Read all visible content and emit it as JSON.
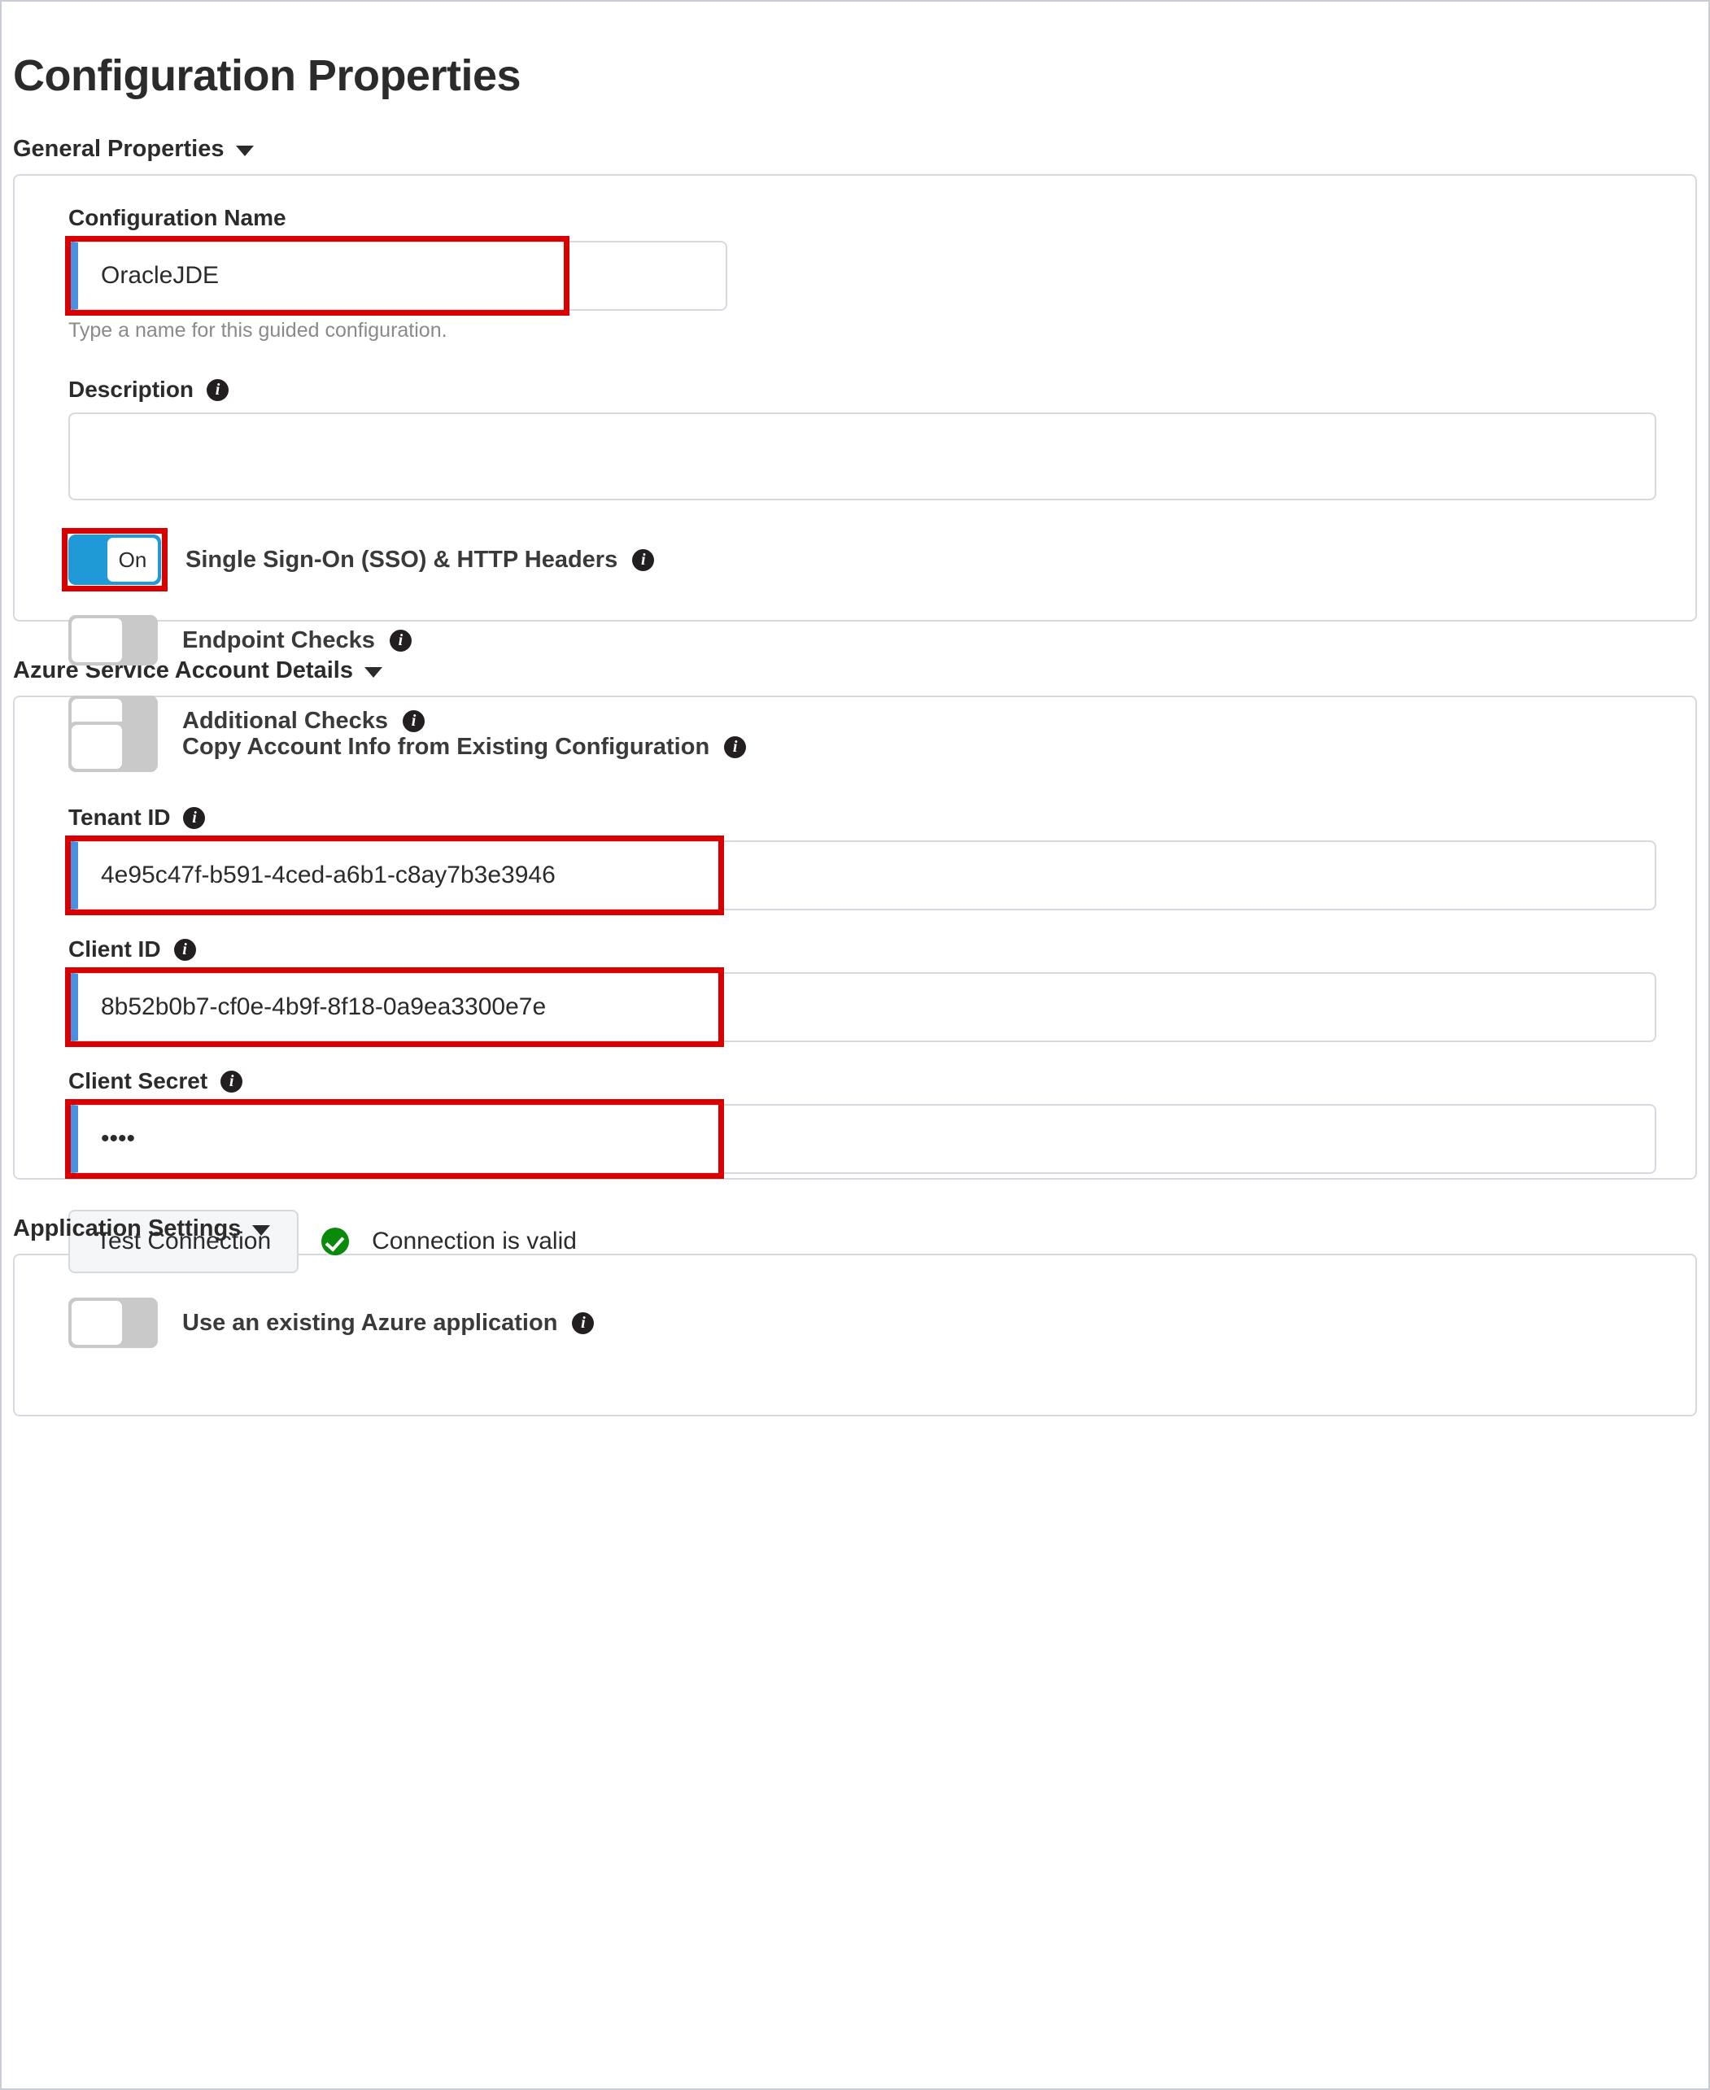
{
  "page": {
    "title": "Configuration Properties"
  },
  "sections": {
    "general": {
      "header": "General Properties",
      "caret_icon": "chevron-down-icon",
      "config_name": {
        "label": "Configuration Name",
        "value": "OracleJDE",
        "placeholder": "",
        "helper": "Type a name for this guided configuration."
      },
      "description": {
        "label": "Description",
        "info_icon": "info-icon",
        "value": "",
        "placeholder": ""
      },
      "toggles": [
        {
          "label": "Single Sign-On (SSO) & HTTP Headers",
          "state": "on",
          "state_label": "On",
          "info_icon": "info-icon",
          "highlighted": true
        },
        {
          "label": "Endpoint Checks",
          "state": "off",
          "state_label": "",
          "info_icon": "info-icon",
          "highlighted": false
        },
        {
          "label": "Additional Checks",
          "state": "off",
          "state_label": "",
          "info_icon": "info-icon",
          "highlighted": false
        }
      ]
    },
    "azure": {
      "header": "Azure Service Account Details",
      "caret_icon": "chevron-down-icon",
      "copy_account_toggle": {
        "label": "Copy Account Info from Existing Configuration",
        "state": "off",
        "info_icon": "info-icon"
      },
      "tenant_id": {
        "label": "Tenant ID",
        "info_icon": "info-icon",
        "value": "4e95c47f-b591-4ced-a6b1-c8ay7b3e3946",
        "placeholder": ""
      },
      "client_id": {
        "label": "Client ID",
        "info_icon": "info-icon",
        "value": "8b52b0b7-cf0e-4b9f-8f18-0a9ea3300e7e",
        "placeholder": ""
      },
      "client_secret": {
        "label": "Client Secret",
        "info_icon": "info-icon",
        "value": "••••",
        "placeholder": ""
      },
      "test_connection": {
        "button_label": "Test Connection",
        "status_icon": "check-circle-icon",
        "status_text": "Connection is valid"
      }
    },
    "application_settings": {
      "header": "Application Settings",
      "caret_icon": "chevron-down-icon",
      "use_existing_toggle": {
        "label": "Use an existing Azure application",
        "state": "off",
        "info_icon": "info-icon"
      }
    }
  },
  "colors": {
    "accent_blue": "#4a90e2",
    "toggle_on": "#1f9ad6",
    "toggle_off": "#c9c9c9",
    "highlight_red": "#d90000",
    "status_green": "#0a8a0a",
    "border_gray": "#d6d9e0"
  }
}
